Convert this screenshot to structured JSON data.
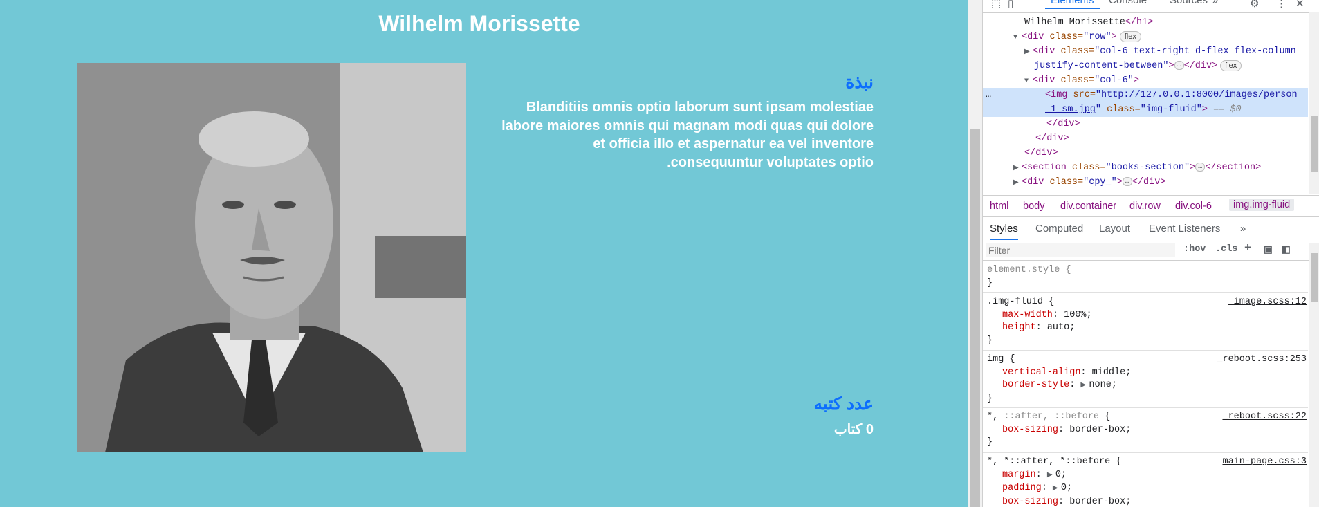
{
  "page": {
    "title": "Wilhelm Morissette",
    "portrait_alt": "portrait photo",
    "bio_heading": "نبذة",
    "bio_text": "Blanditiis omnis optio laborum sunt ipsam molestiae labore maiores omnis qui magnam modi quas qui dolore et officia illo et aspernatur ea vel inventore consequuntur voluptates optio.",
    "books_heading": "عدد كتبه",
    "books_count": "0 كتاب",
    "bg_color": "#72c8d6",
    "accent_color": "#0d6efd"
  },
  "devtools": {
    "tabs": [
      "Elements",
      "Console",
      "Sources"
    ],
    "more_tabs": "»",
    "dom": {
      "l0_text": "Wilhelm Morissette",
      "l0_close": "</h1>",
      "l1_tag": "<div ",
      "l1_attr": "class=",
      "l1_val": "\"row\"",
      "l1_end": ">",
      "l1_pill": "flex",
      "l2_tag": "<div ",
      "l2_attr": "class=",
      "l2_val": "\"col-6 text-right d-flex flex-column",
      "l3_val": "justify-content-between\"",
      "l3_mid": ">",
      "l3_ell": "…",
      "l3_close": "</div>",
      "l3_pill": "flex",
      "l4_tag": "<div ",
      "l4_attr": "class=",
      "l4_val": "\"col-6\"",
      "l4_end": ">",
      "l5_gutter": "…",
      "l5_tag": "<img ",
      "l5_attr": "src=",
      "l5_q": "\"",
      "l5_link": "http://127.0.0.1:8000/images/person",
      "l6_link": "_1_sm.jpg",
      "l6_q": "\"",
      "l6_attr": " class=",
      "l6_val": "\"img-fluid\"",
      "l6_end": ">",
      "l6_eq": " == $0",
      "l7": "</div>",
      "l8": "</div>",
      "l9": "</div>",
      "l10_tag": "<section ",
      "l10_attr": "class=",
      "l10_val": "\"books-section\"",
      "l10_end": ">",
      "l10_ell": "…",
      "l10_close": "</section>",
      "l11_tag": "<div ",
      "l11_attr": "class=",
      "l11_val": "\"cpy_\"",
      "l11_end": ">",
      "l11_ell": "…",
      "l11_close": "</div>"
    },
    "breadcrumbs": [
      "html",
      "body",
      "div.container",
      "div.row",
      "div.col-6",
      "img.img-fluid"
    ],
    "style_tabs": [
      "Styles",
      "Computed",
      "Layout",
      "Event Listeners",
      "»"
    ],
    "filter_placeholder": "Filter",
    "filter_buttons": [
      ":hov",
      ".cls",
      "+"
    ],
    "rules": {
      "r1_sel": "element.style {",
      "r1_close": "}",
      "r2_sel": ".img-fluid {",
      "r2_src": "_image.scss:12",
      "r2_p1": "max-width",
      "r2_v1": "100%;",
      "r2_p2": "height",
      "r2_v2": "auto;",
      "r2_close": "}",
      "r3_sel": "img {",
      "r3_src": "_reboot.scss:253",
      "r3_p1": "vertical-align",
      "r3_v1": "middle;",
      "r3_p2": "border-style",
      "r3_v2": "none;",
      "r3_close": "}",
      "r4_sel_a": "*, ",
      "r4_sel_b": "::after, ::before",
      "r4_sel_c": " {",
      "r4_src": "_reboot.scss:22",
      "r4_p1": "box-sizing",
      "r4_v1": "border-box;",
      "r4_close": "}",
      "r5_sel": "*, *::after, *::before {",
      "r5_src": "main-page.css:3",
      "r5_p1": "margin",
      "r5_v1": "0;",
      "r5_p2": "padding",
      "r5_v2": "0;",
      "r5_p3": "box-sizing",
      "r5_v3": "border-box;"
    }
  }
}
